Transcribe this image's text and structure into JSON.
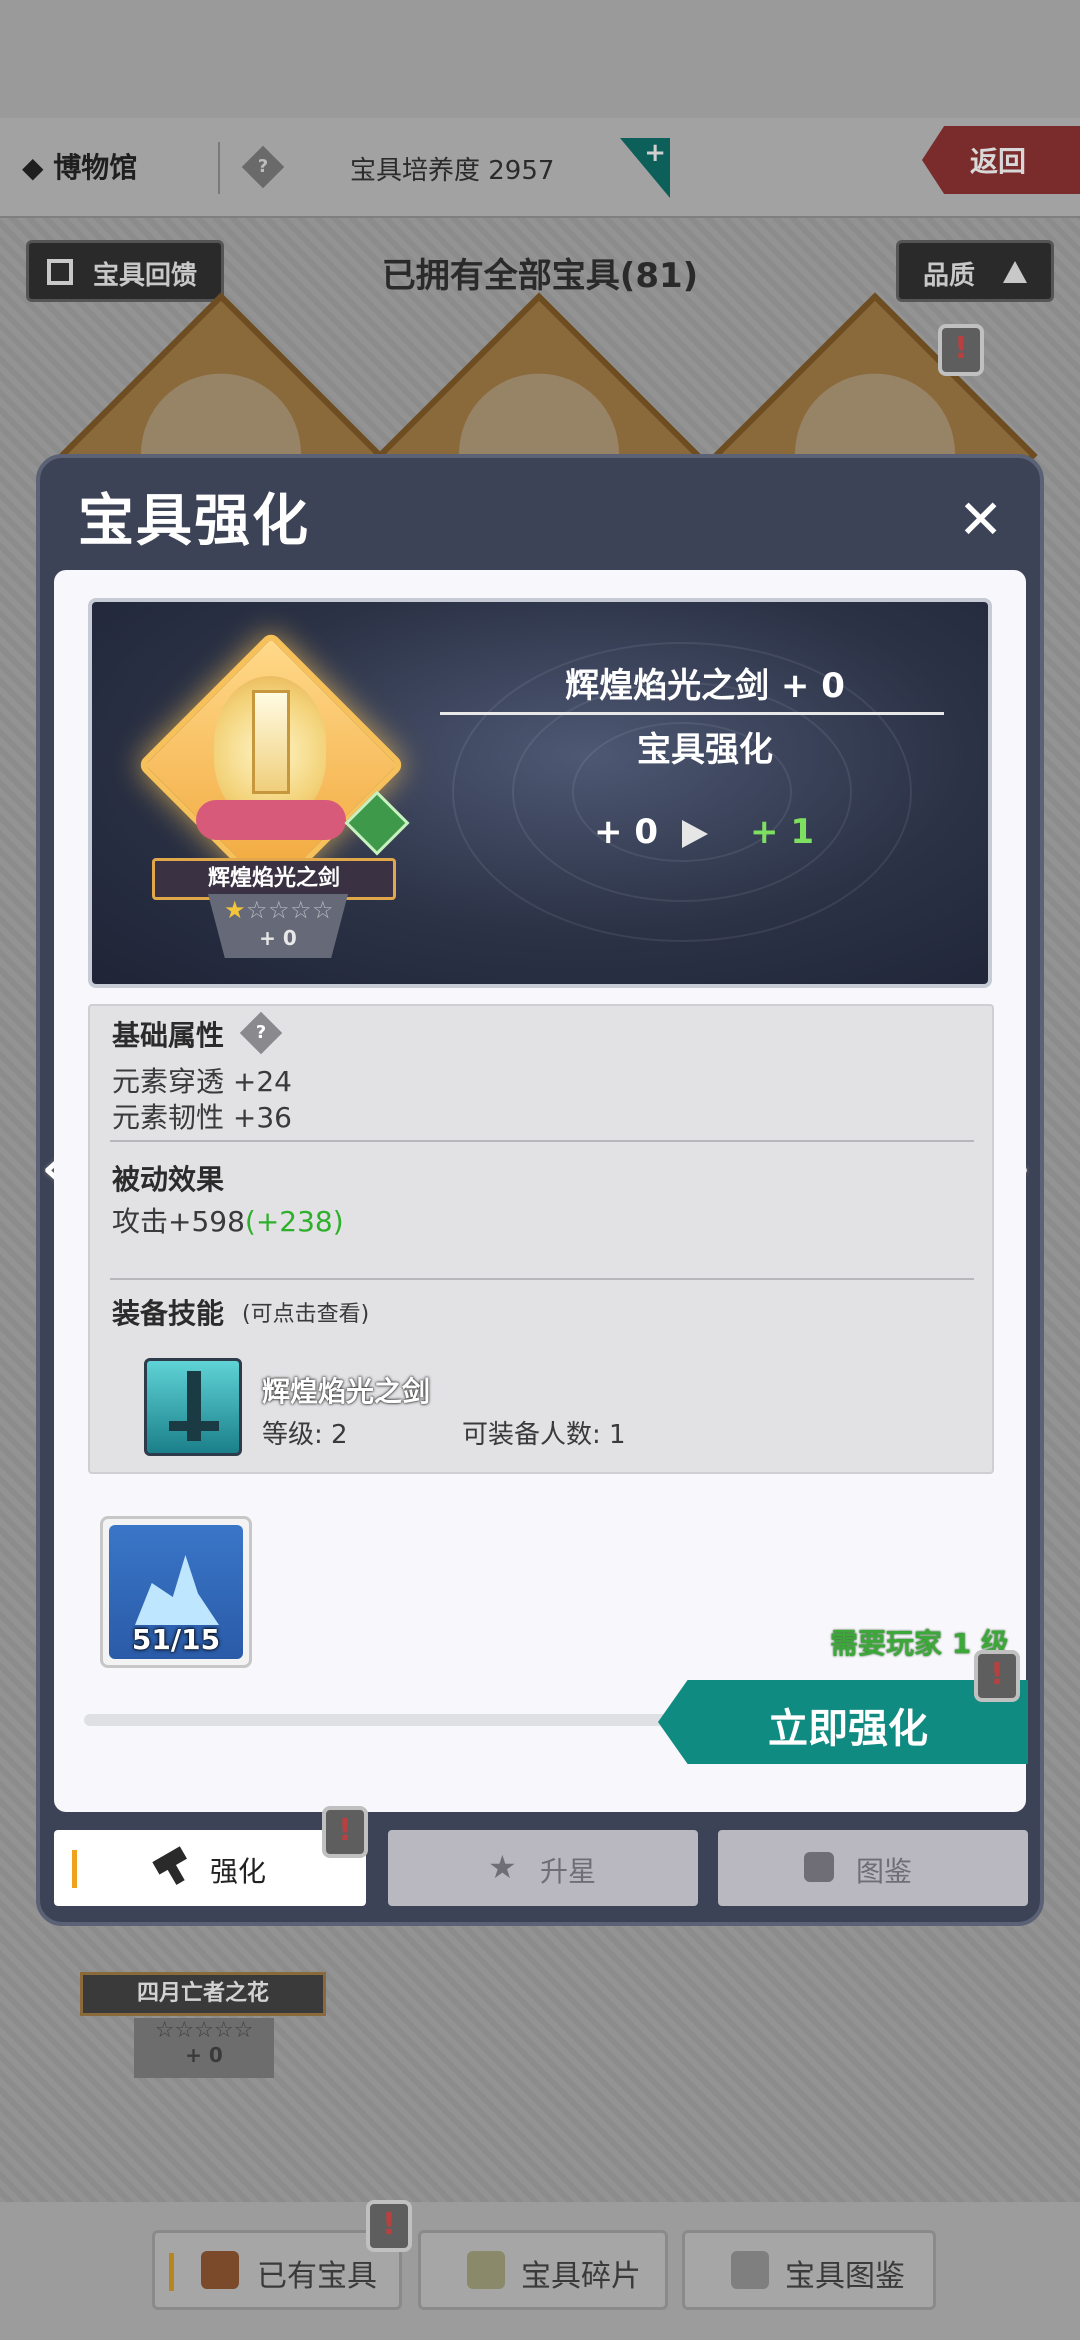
{
  "header": {
    "title": "◆ 博物馆",
    "help_icon": "?",
    "nurture": "宝具培养度 2957",
    "back": "返回"
  },
  "strip": {
    "feedback": "宝具回馈",
    "owned_all": "已拥有全部宝具(81)",
    "quality": "品质"
  },
  "modal": {
    "title": "宝具强化",
    "close": "✕",
    "hero": {
      "name_level": "辉煌焰光之剑 + 0",
      "subtitle": "宝具强化",
      "level_from": "+ 0",
      "level_to": "+ 1",
      "artifact_name": "辉煌焰光之剑",
      "artifact_plus": "+ 0",
      "stars_filled": 1,
      "stars_total": 5
    },
    "attributes": {
      "base_title": "基础属性",
      "base_lines": [
        "元素穿透 +24",
        "元素韧性 +36"
      ],
      "passive_title": "被动效果",
      "passive_value": "攻击+598",
      "passive_bonus": "(+238)",
      "skill_title": "装备技能",
      "skill_hint": "(可点击查看)",
      "skill_name": "辉煌焰光之剑",
      "skill_level": "等级: 2",
      "skill_equip_count": "可装备人数: 1"
    },
    "material": {
      "count": "51/15"
    },
    "requirement": "需要玩家 1 级",
    "enhance_button": "立即强化",
    "tabs": [
      {
        "label": "强化"
      },
      {
        "label": "升星"
      },
      {
        "label": "图鉴"
      }
    ],
    "alert": "!"
  },
  "background_item": {
    "name": "四月亡者之花",
    "plus": "+ 0"
  },
  "bottom_nav": [
    {
      "label": "已有宝具"
    },
    {
      "label": "宝具碎片"
    },
    {
      "label": "宝具图鉴"
    }
  ],
  "colors": {
    "accent_teal": "#0f8b82",
    "bonus_green": "#3da83a",
    "level_to_green": "#7ee060",
    "tab_marker": "#f1a21d"
  }
}
